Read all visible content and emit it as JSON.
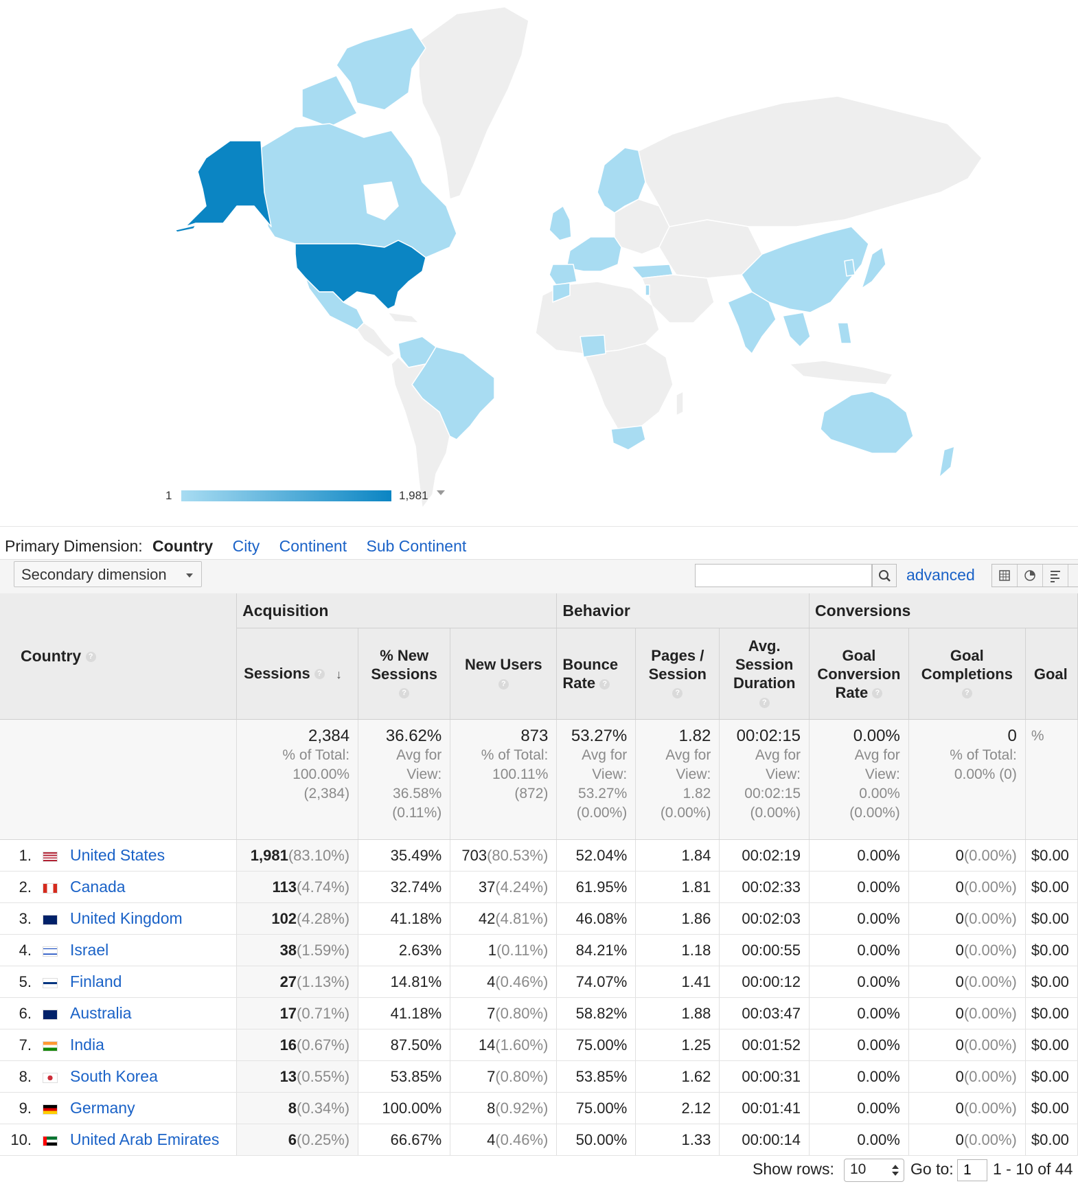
{
  "legend": {
    "min": "1",
    "max": "1,981"
  },
  "dimensions": {
    "label": "Primary Dimension:",
    "current": "Country",
    "options": [
      "City",
      "Continent",
      "Sub Continent"
    ]
  },
  "toolbar": {
    "secondary_dimension": "Secondary dimension",
    "search_value": "",
    "advanced": "advanced"
  },
  "icons": {
    "search": "search-icon",
    "views": [
      "table-view-icon",
      "pie-view-icon",
      "performance-view-icon"
    ]
  },
  "colors": {
    "map_high": "#0b85c3",
    "map_low": "#a8dcf2",
    "link": "#1a62c7"
  },
  "table": {
    "groups": [
      "Acquisition",
      "Behavior",
      "Conversions"
    ],
    "country_header": "Country",
    "columns": [
      "Sessions",
      "% New Sessions",
      "New Users",
      "Bounce Rate",
      "Pages / Session",
      "Avg. Session Duration",
      "Goal Conversion Rate",
      "Goal Completions",
      "Goal"
    ],
    "totals": [
      {
        "value": "2,384",
        "sub": [
          "% of Total:",
          "100.00%",
          "(2,384)"
        ]
      },
      {
        "value": "36.62%",
        "sub": [
          "Avg for",
          "View:",
          "36.58%",
          "(0.11%)"
        ]
      },
      {
        "value": "873",
        "sub": [
          "% of Total:",
          "100.11%",
          "(872)"
        ]
      },
      {
        "value": "53.27%",
        "sub": [
          "Avg for",
          "View:",
          "53.27%",
          "(0.00%)"
        ]
      },
      {
        "value": "1.82",
        "sub": [
          "Avg for",
          "View:",
          "1.82",
          "(0.00%)"
        ]
      },
      {
        "value": "00:02:15",
        "sub": [
          "Avg for",
          "View:",
          "00:02:15",
          "(0.00%)"
        ]
      },
      {
        "value": "0.00%",
        "sub": [
          "Avg for",
          "View:",
          "0.00%",
          "(0.00%)"
        ]
      },
      {
        "value": "0",
        "sub": [
          "% of Total:",
          "0.00% (0)"
        ]
      },
      {
        "value": "",
        "sub": [
          "%"
        ]
      }
    ],
    "rows": [
      {
        "idx": "1.",
        "country": "United States",
        "flag": "us",
        "sessions": "1,981",
        "sessions_pct": "(83.10%)",
        "new_sessions": "35.49%",
        "new_users": "703",
        "new_users_pct": "(80.53%)",
        "bounce": "52.04%",
        "pages": "1.84",
        "duration": "00:02:19",
        "conv": "0.00%",
        "goal": "0",
        "goal_pct": "(0.00%)",
        "value": "$0.00"
      },
      {
        "idx": "2.",
        "country": "Canada",
        "flag": "ca",
        "sessions": "113",
        "sessions_pct": "(4.74%)",
        "new_sessions": "32.74%",
        "new_users": "37",
        "new_users_pct": "(4.24%)",
        "bounce": "61.95%",
        "pages": "1.81",
        "duration": "00:02:33",
        "conv": "0.00%",
        "goal": "0",
        "goal_pct": "(0.00%)",
        "value": "$0.00"
      },
      {
        "idx": "3.",
        "country": "United Kingdom",
        "flag": "gb",
        "sessions": "102",
        "sessions_pct": "(4.28%)",
        "new_sessions": "41.18%",
        "new_users": "42",
        "new_users_pct": "(4.81%)",
        "bounce": "46.08%",
        "pages": "1.86",
        "duration": "00:02:03",
        "conv": "0.00%",
        "goal": "0",
        "goal_pct": "(0.00%)",
        "value": "$0.00"
      },
      {
        "idx": "4.",
        "country": "Israel",
        "flag": "il",
        "sessions": "38",
        "sessions_pct": "(1.59%)",
        "new_sessions": "2.63%",
        "new_users": "1",
        "new_users_pct": "(0.11%)",
        "bounce": "84.21%",
        "pages": "1.18",
        "duration": "00:00:55",
        "conv": "0.00%",
        "goal": "0",
        "goal_pct": "(0.00%)",
        "value": "$0.00"
      },
      {
        "idx": "5.",
        "country": "Finland",
        "flag": "fi",
        "sessions": "27",
        "sessions_pct": "(1.13%)",
        "new_sessions": "14.81%",
        "new_users": "4",
        "new_users_pct": "(0.46%)",
        "bounce": "74.07%",
        "pages": "1.41",
        "duration": "00:00:12",
        "conv": "0.00%",
        "goal": "0",
        "goal_pct": "(0.00%)",
        "value": "$0.00"
      },
      {
        "idx": "6.",
        "country": "Australia",
        "flag": "au",
        "sessions": "17",
        "sessions_pct": "(0.71%)",
        "new_sessions": "41.18%",
        "new_users": "7",
        "new_users_pct": "(0.80%)",
        "bounce": "58.82%",
        "pages": "1.88",
        "duration": "00:03:47",
        "conv": "0.00%",
        "goal": "0",
        "goal_pct": "(0.00%)",
        "value": "$0.00"
      },
      {
        "idx": "7.",
        "country": "India",
        "flag": "in",
        "sessions": "16",
        "sessions_pct": "(0.67%)",
        "new_sessions": "87.50%",
        "new_users": "14",
        "new_users_pct": "(1.60%)",
        "bounce": "75.00%",
        "pages": "1.25",
        "duration": "00:01:52",
        "conv": "0.00%",
        "goal": "0",
        "goal_pct": "(0.00%)",
        "value": "$0.00"
      },
      {
        "idx": "8.",
        "country": "South Korea",
        "flag": "kr",
        "sessions": "13",
        "sessions_pct": "(0.55%)",
        "new_sessions": "53.85%",
        "new_users": "7",
        "new_users_pct": "(0.80%)",
        "bounce": "53.85%",
        "pages": "1.62",
        "duration": "00:00:31",
        "conv": "0.00%",
        "goal": "0",
        "goal_pct": "(0.00%)",
        "value": "$0.00"
      },
      {
        "idx": "9.",
        "country": "Germany",
        "flag": "de",
        "sessions": "8",
        "sessions_pct": "(0.34%)",
        "new_sessions": "100.00%",
        "new_users": "8",
        "new_users_pct": "(0.92%)",
        "bounce": "75.00%",
        "pages": "2.12",
        "duration": "00:01:41",
        "conv": "0.00%",
        "goal": "0",
        "goal_pct": "(0.00%)",
        "value": "$0.00"
      },
      {
        "idx": "10.",
        "country": "United Arab Emirates",
        "flag": "ae",
        "sessions": "6",
        "sessions_pct": "(0.25%)",
        "new_sessions": "66.67%",
        "new_users": "4",
        "new_users_pct": "(0.46%)",
        "bounce": "50.00%",
        "pages": "1.33",
        "duration": "00:00:14",
        "conv": "0.00%",
        "goal": "0",
        "goal_pct": "(0.00%)",
        "value": "$0.00"
      }
    ]
  },
  "pager": {
    "show_rows_label": "Show rows:",
    "rows_value": "10",
    "goto_label": "Go to:",
    "goto_value": "1",
    "range": "1 - 10 of 44"
  }
}
